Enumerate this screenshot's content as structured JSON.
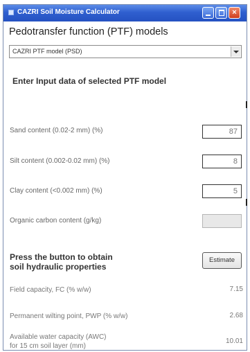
{
  "window": {
    "title": "CAZRI Soil Moisture Calculator",
    "minimize_glyph": "",
    "maximize_glyph": "",
    "close_glyph": "×"
  },
  "heading": "Pedotransfer function (PTF) models",
  "model_select": {
    "selected": "CAZRI PTF model (PSD)"
  },
  "input_section_title": "Enter Input data of selected PTF model",
  "inputs": [
    {
      "label": "Sand content (0.02-2 mm) (%)",
      "value": "87"
    },
    {
      "label": "Silt content (0.002-0.02 mm) (%)",
      "value": "8"
    },
    {
      "label": "Clay content (<0.002 mm) (%)",
      "value": "5"
    },
    {
      "label": "Organic carbon content (g/kg)",
      "value": ""
    }
  ],
  "estimate_prompt": {
    "line1": "Press the button to obtain",
    "line2": "soil hydraulic properties"
  },
  "estimate_button": "Estimate",
  "outputs": [
    {
      "label": "Field capacity, FC  (% w/w)",
      "value": "7.15"
    },
    {
      "label": "Permanent wilting point, PWP  (% w/w)",
      "value": "2.68"
    },
    {
      "label_line1": "Available water capacity (AWC)",
      "label_line2": "for 15 cm soil layer (mm)",
      "value": "10.01"
    }
  ],
  "colors": {
    "titlebar": "#2f5fcf",
    "close_button": "#cf3f1e",
    "text": "#333333",
    "muted_text": "#777777"
  },
  "icons": [
    "app-icon",
    "minimize-icon",
    "maximize-icon",
    "close-icon",
    "dropdown-arrow-icon"
  ]
}
